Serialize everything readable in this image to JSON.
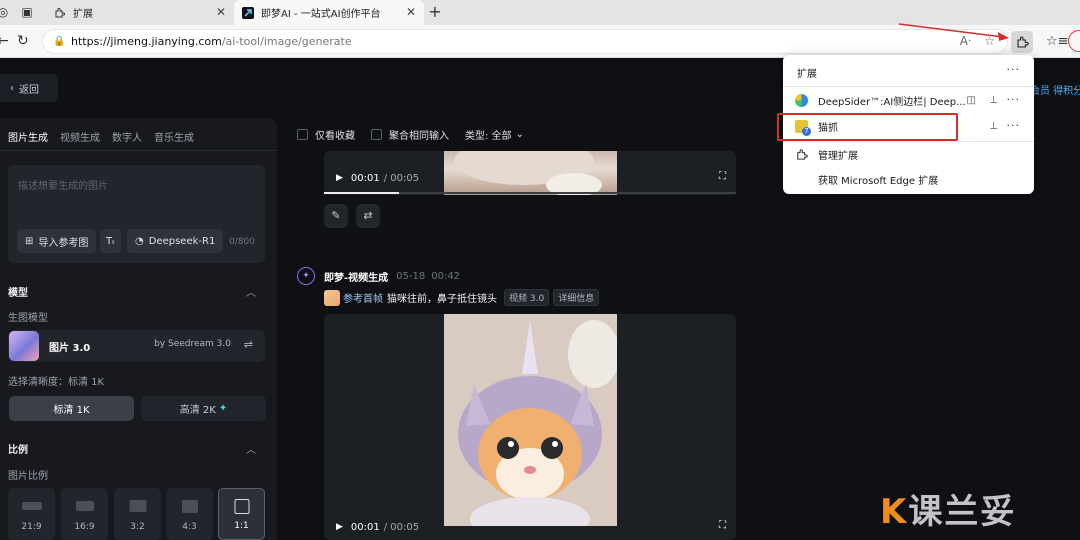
{
  "browser": {
    "tabs": [
      {
        "label": "扩展"
      },
      {
        "label": "即梦AI - 一站式AI创作平台"
      }
    ],
    "url_host": "https://jimeng.jianying.com",
    "url_path": "/ai-tool/image/generate"
  },
  "extensions_popup": {
    "title": "扩展",
    "items": [
      {
        "label": "DeepSider™:AI侧边栏| Deep..."
      },
      {
        "label": "猫抓",
        "badge": "7"
      },
      {
        "label": "管理扩展"
      },
      {
        "label": "获取 Microsoft Edge 扩展"
      }
    ]
  },
  "app": {
    "back_label": "返回",
    "member_text": "会员 得积分",
    "tabs": [
      "图片生成",
      "视频生成",
      "数字人",
      "音乐生成"
    ],
    "prompt_placeholder": "描述想要生成的图片",
    "import_ref": "导入参考图",
    "model_btn": "Deepseek-R1",
    "char_count": "0/800",
    "model_section": "模型",
    "model_sub": "生图模型",
    "model_name": "图片 3.0",
    "model_by": "by Seedream 3.0",
    "quality_label": "选择清晰度：标清 1K",
    "q1": "标清 1K",
    "q2": "高清 2K",
    "ratio_section": "比例",
    "ratio_sub": "图片比例",
    "ratios": [
      "21:9",
      "16:9",
      "3:2",
      "4:3",
      "1:1"
    ]
  },
  "filters": {
    "only_fav": "仅看收藏",
    "merge": "聚合相同输入",
    "type": "类型: 全部"
  },
  "video1": {
    "time": "00:01",
    "duration": "/ 00:05"
  },
  "generation": {
    "name": "即梦-视频生成",
    "date": "05-18",
    "clock": "00:42",
    "ref_label": "参考首帧",
    "desc": "猫咪往前，鼻子抵住镜头",
    "tag1": "视频 3.0",
    "tag2": "详细信息"
  },
  "video2": {
    "time": "00:01",
    "duration": "/ 00:05"
  },
  "watermark": {
    "k": "K",
    "rest": "课兰妥"
  }
}
